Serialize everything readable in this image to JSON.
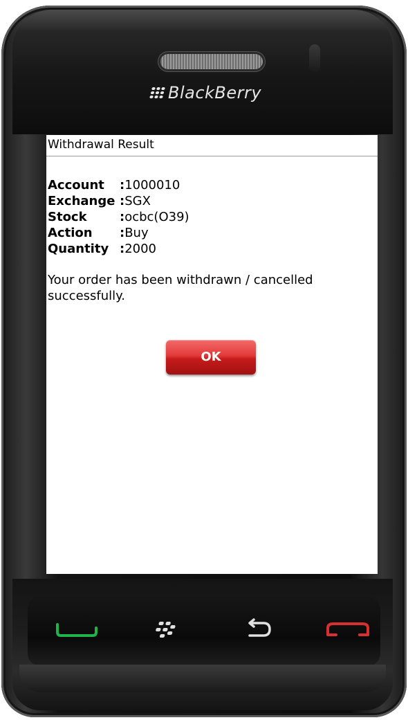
{
  "device": {
    "brand": "BlackBerry"
  },
  "screen": {
    "title": "Withdrawal Result",
    "details": [
      {
        "label": "Account",
        "value": "1000010"
      },
      {
        "label": "Exchange",
        "value": "SGX"
      },
      {
        "label": "Stock",
        "value": "ocbc(O39)"
      },
      {
        "label": "Action",
        "value": "Buy"
      },
      {
        "label": "Quantity",
        "value": "2000"
      }
    ],
    "message": "Your order has been withdrawn / cancelled successfully.",
    "ok_label": "OK"
  },
  "keys": {
    "call": "call-key-icon",
    "menu": "menu-key-icon",
    "back": "back-key-icon",
    "end": "end-call-key-icon"
  },
  "colors": {
    "ok_button": "#d92a2a",
    "call_key": "#1fb34a",
    "end_key": "#d83030"
  }
}
